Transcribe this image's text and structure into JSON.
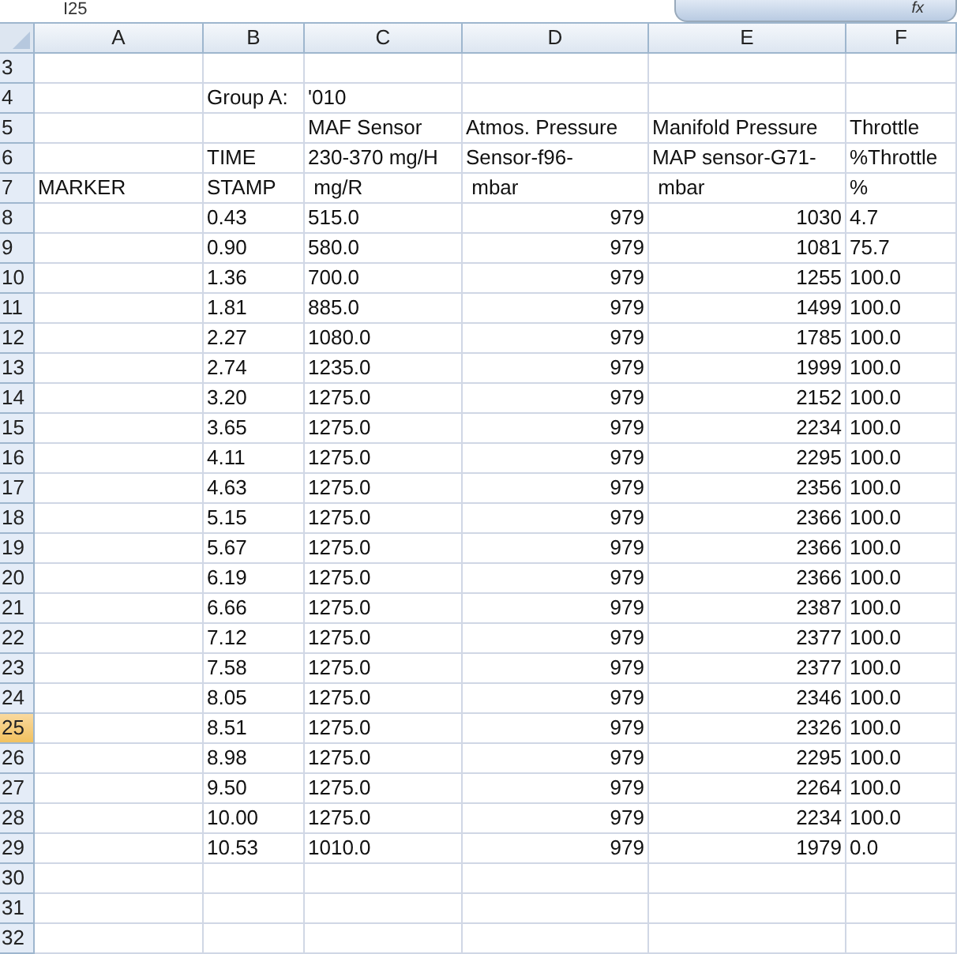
{
  "formula_bar": {
    "name_box": "I25",
    "function_label": "fx"
  },
  "columns": [
    {
      "label": "A",
      "selected": false
    },
    {
      "label": "B",
      "selected": false
    },
    {
      "label": "C",
      "selected": false
    },
    {
      "label": "D",
      "selected": false
    },
    {
      "label": "E",
      "selected": false
    },
    {
      "label": "F",
      "selected": false
    }
  ],
  "rows": [
    {
      "number": "3",
      "selected": false,
      "kind": "text",
      "cells": [
        "",
        "",
        "",
        "",
        "",
        ""
      ]
    },
    {
      "number": "4",
      "selected": false,
      "kind": "text",
      "cells": [
        "",
        "Group A:",
        "'010",
        "",
        "",
        ""
      ]
    },
    {
      "number": "5",
      "selected": false,
      "kind": "text",
      "cells": [
        "",
        "",
        "MAF Sensor",
        "Atmos. Pressure",
        "Manifold Pressure",
        "Throttle"
      ]
    },
    {
      "number": "6",
      "selected": false,
      "kind": "text",
      "cells": [
        "",
        "TIME",
        "230-370 mg/H",
        "Sensor-f96-",
        "MAP sensor-G71-",
        "%Throttle"
      ]
    },
    {
      "number": "7",
      "selected": false,
      "kind": "text",
      "cells": [
        "MARKER",
        "STAMP",
        " mg/R",
        " mbar",
        " mbar",
        "%"
      ]
    },
    {
      "number": "8",
      "selected": false,
      "kind": "data",
      "cells": [
        "",
        "0.43",
        "515.0",
        "979",
        "1030",
        "4.7"
      ]
    },
    {
      "number": "9",
      "selected": false,
      "kind": "data",
      "cells": [
        "",
        "0.90",
        "580.0",
        "979",
        "1081",
        "75.7"
      ]
    },
    {
      "number": "10",
      "selected": false,
      "kind": "data",
      "cells": [
        "",
        "1.36",
        "700.0",
        "979",
        "1255",
        "100.0"
      ]
    },
    {
      "number": "11",
      "selected": false,
      "kind": "data",
      "cells": [
        "",
        "1.81",
        "885.0",
        "979",
        "1499",
        "100.0"
      ]
    },
    {
      "number": "12",
      "selected": false,
      "kind": "data",
      "cells": [
        "",
        "2.27",
        "1080.0",
        "979",
        "1785",
        "100.0"
      ]
    },
    {
      "number": "13",
      "selected": false,
      "kind": "data",
      "cells": [
        "",
        "2.74",
        "1235.0",
        "979",
        "1999",
        "100.0"
      ]
    },
    {
      "number": "14",
      "selected": false,
      "kind": "data",
      "cells": [
        "",
        "3.20",
        "1275.0",
        "979",
        "2152",
        "100.0"
      ]
    },
    {
      "number": "15",
      "selected": false,
      "kind": "data",
      "cells": [
        "",
        "3.65",
        "1275.0",
        "979",
        "2234",
        "100.0"
      ]
    },
    {
      "number": "16",
      "selected": false,
      "kind": "data",
      "cells": [
        "",
        "4.11",
        "1275.0",
        "979",
        "2295",
        "100.0"
      ]
    },
    {
      "number": "17",
      "selected": false,
      "kind": "data",
      "cells": [
        "",
        "4.63",
        "1275.0",
        "979",
        "2356",
        "100.0"
      ]
    },
    {
      "number": "18",
      "selected": false,
      "kind": "data",
      "cells": [
        "",
        "5.15",
        "1275.0",
        "979",
        "2366",
        "100.0"
      ]
    },
    {
      "number": "19",
      "selected": false,
      "kind": "data",
      "cells": [
        "",
        "5.67",
        "1275.0",
        "979",
        "2366",
        "100.0"
      ]
    },
    {
      "number": "20",
      "selected": false,
      "kind": "data",
      "cells": [
        "",
        "6.19",
        "1275.0",
        "979",
        "2366",
        "100.0"
      ]
    },
    {
      "number": "21",
      "selected": false,
      "kind": "data",
      "cells": [
        "",
        "6.66",
        "1275.0",
        "979",
        "2387",
        "100.0"
      ]
    },
    {
      "number": "22",
      "selected": false,
      "kind": "data",
      "cells": [
        "",
        "7.12",
        "1275.0",
        "979",
        "2377",
        "100.0"
      ]
    },
    {
      "number": "23",
      "selected": false,
      "kind": "data",
      "cells": [
        "",
        "7.58",
        "1275.0",
        "979",
        "2377",
        "100.0"
      ]
    },
    {
      "number": "24",
      "selected": false,
      "kind": "data",
      "cells": [
        "",
        "8.05",
        "1275.0",
        "979",
        "2346",
        "100.0"
      ]
    },
    {
      "number": "25",
      "selected": true,
      "kind": "data",
      "cells": [
        "",
        "8.51",
        "1275.0",
        "979",
        "2326",
        "100.0"
      ]
    },
    {
      "number": "26",
      "selected": false,
      "kind": "data",
      "cells": [
        "",
        "8.98",
        "1275.0",
        "979",
        "2295",
        "100.0"
      ]
    },
    {
      "number": "27",
      "selected": false,
      "kind": "data",
      "cells": [
        "",
        "9.50",
        "1275.0",
        "979",
        "2264",
        "100.0"
      ]
    },
    {
      "number": "28",
      "selected": false,
      "kind": "data",
      "cells": [
        "",
        "10.00",
        "1275.0",
        "979",
        "2234",
        "100.0"
      ]
    },
    {
      "number": "29",
      "selected": false,
      "kind": "data",
      "cells": [
        "",
        "10.53",
        "1010.0",
        "979",
        "1979",
        "0.0"
      ]
    },
    {
      "number": "30",
      "selected": false,
      "kind": "text",
      "cells": [
        "",
        "",
        "",
        "",
        "",
        ""
      ]
    },
    {
      "number": "31",
      "selected": false,
      "kind": "text",
      "cells": [
        "",
        "",
        "",
        "",
        "",
        ""
      ]
    },
    {
      "number": "32",
      "selected": false,
      "kind": "text",
      "cells": [
        "",
        "",
        "",
        "",
        "",
        ""
      ]
    }
  ]
}
